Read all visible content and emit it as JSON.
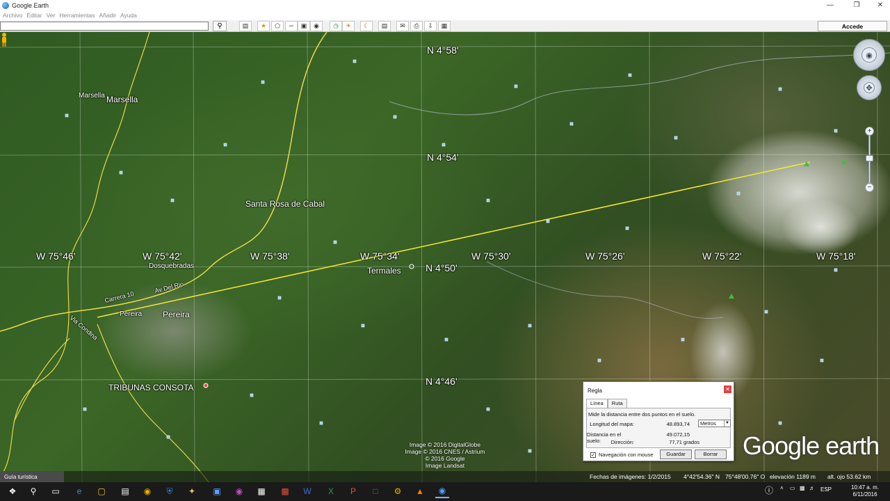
{
  "window": {
    "title": "Google Earth",
    "controls": [
      "—",
      "❐",
      "✕"
    ]
  },
  "menu": [
    "Archivo",
    "Editar",
    "Ver",
    "Herramientas",
    "Añadir",
    "Ayuda"
  ],
  "toolbar": {
    "search_value": "",
    "signin_label": "Accede",
    "buttons": [
      "sidebar-icon",
      "placemark-icon",
      "polygon-icon",
      "path-icon",
      "image-overlay-icon",
      "record-tour-icon",
      "historical-imagery-icon",
      "sunlight-icon",
      "planets-icon",
      "ruler-icon",
      "email-icon",
      "print-icon",
      "save-image-icon",
      "view-in-maps-icon"
    ]
  },
  "map": {
    "coords": {
      "lat_458": "N 4°58'",
      "lat_454": "N 4°54'",
      "lat_450": "N 4°50'",
      "lat_446": "N 4°46'",
      "lon_7546": "W 75°46'",
      "lon_7542": "W 75°42'",
      "lon_7538": "W 75°38'",
      "lon_7534": "W 75°34'",
      "lon_7530": "W 75°30'",
      "lon_7526": "W 75°26'",
      "lon_7522": "W 75°22'",
      "lon_7518": "W 75°18'"
    },
    "places": {
      "marsella_small": "Marsella",
      "marsella": "Marsella",
      "santa_rosa": "Santa Rosa de Cabal",
      "termales": "Termales",
      "dosquebradas": "Dosquebradas",
      "pereira_small": "Pereira",
      "pereira": "Pereira",
      "tribunas": "TRIBUNAS CONSOTA",
      "av_del_rio": "Av Del Rio",
      "carrera_10": "Carrera 10",
      "via_condina": "Via Condina"
    },
    "credits": [
      "Image © 2016 DigitalGlobe",
      "Image © 2016 CNES / Astrium",
      "© 2016 Google",
      "Image Landsat"
    ],
    "brand": "Google earth"
  },
  "ruler": {
    "title": "Regla",
    "tabs": [
      "Línea",
      "Ruta"
    ],
    "description": "Mide la distancia entre dos puntos en el suelo.",
    "map_length_label": "Longitud del mapa:",
    "map_length_value": "48.893,74",
    "unit": "Metros",
    "ground_length_label": "Distancia en el suelo:",
    "ground_length_value": "49.072,15",
    "heading_label": "Dirección:",
    "heading_value": "77,71 grados",
    "mouse_nav_label": "Navegación con mouse",
    "mouse_nav_checked": true,
    "save_label": "Guardar",
    "clear_label": "Borrar"
  },
  "status": {
    "tour": "Guía turística",
    "imagery_date": "Fechas de imágenes: 1/2/2015",
    "lat": "4°42'54.36\" N",
    "lon": "75°48'00.76\" O",
    "elevation": "elevación  1189 m",
    "eye_alt": "alt. ojo  53.62 km"
  },
  "taskbar": {
    "lang": "ESP",
    "time": "10:47 a. m.",
    "date": "6/11/2016"
  }
}
